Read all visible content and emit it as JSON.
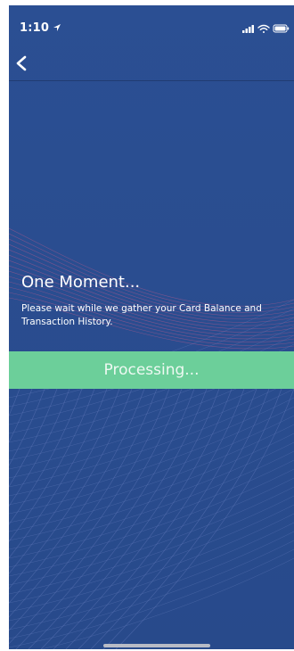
{
  "status_bar": {
    "time": "1:10",
    "icons": [
      "location-arrow-icon",
      "signal-icon",
      "wifi-icon",
      "battery-icon"
    ]
  },
  "nav": {
    "back_icon": "chevron-left-icon"
  },
  "content": {
    "title": "One Moment...",
    "message": "Please wait while we gather your Card Balance and Transaction History."
  },
  "processing": {
    "label": "Processing..."
  },
  "colors": {
    "background": "#2a4d8f",
    "processing_bar": "#6ccf9a",
    "text": "#ffffff",
    "wave_lines": "#c75a8c"
  }
}
